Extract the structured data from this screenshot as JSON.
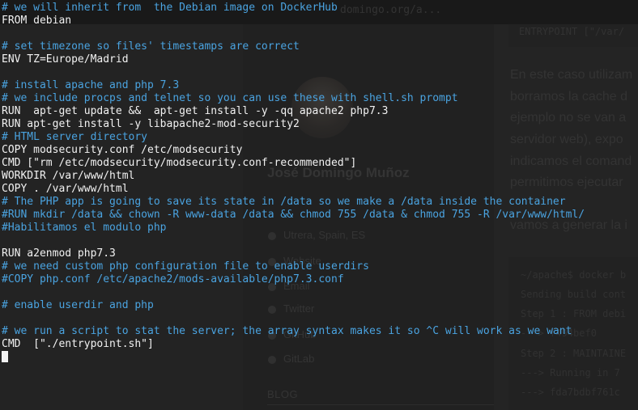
{
  "background_page": {
    "top_bar_text": "domingo.org/a...",
    "code_top": "ENTRYPOINT [\"/var/",
    "author_name": "José Domingo Muñoz",
    "location": "Utrera, Spain, ES",
    "links": [
      "Website",
      "Email",
      "Twitter",
      "GitHub",
      "GitLab"
    ],
    "blog_heading": "BLOG",
    "paragraph_lines": [
      "En este caso utilizam",
      "borramos la cache d",
      "ejemplo no se van a",
      "servidor web), expo",
      "indicamos el comand",
      "permitimos ejecutar",
      "vamos a generar la i"
    ],
    "code_lines": [
      "~/apache$ docker b",
      "Sending build cont",
      "Step 1 : FROM debi",
      " ---> f494bef0",
      "Step 2 : MAINTAINE",
      " ---> Running in 7",
      " ---> fda7bdbf761c"
    ]
  },
  "terminal": {
    "lines": [
      {
        "type": "comment",
        "text": "# we will inherit from  the Debian image on DockerHub"
      },
      {
        "type": "code",
        "text": "FROM debian"
      },
      {
        "type": "blank",
        "text": ""
      },
      {
        "type": "comment",
        "text": "# set timezone so files' timestamps are correct"
      },
      {
        "type": "code",
        "text": "ENV TZ=Europe/Madrid"
      },
      {
        "type": "blank",
        "text": ""
      },
      {
        "type": "comment",
        "text": "# install apache and php 7.3"
      },
      {
        "type": "comment",
        "text": "# we include procps and telnet so you can use these with shell.sh prompt"
      },
      {
        "type": "code",
        "text": "RUN  apt-get update &&  apt-get install -y -qq apache2 php7.3"
      },
      {
        "type": "code",
        "text": "RUN apt-get install -y libapache2-mod-security2"
      },
      {
        "type": "comment",
        "text": "# HTML server directory"
      },
      {
        "type": "code",
        "text": "COPY modsecurity.conf /etc/modsecurity"
      },
      {
        "type": "code",
        "text": "CMD [\"rm /etc/modsecurity/modsecurity.conf-recommended\"]"
      },
      {
        "type": "code",
        "text": "WORKDIR /var/www/html"
      },
      {
        "type": "code",
        "text": "COPY . /var/www/html"
      },
      {
        "type": "comment",
        "text": "# The PHP app is going to save its state in /data so we make a /data inside the container"
      },
      {
        "type": "comment",
        "text": "#RUN mkdir /data && chown -R www-data /data && chmod 755 /data & chmod 755 -R /var/www/html/"
      },
      {
        "type": "comment",
        "text": "#Habilitamos el modulo php"
      },
      {
        "type": "blank",
        "text": ""
      },
      {
        "type": "code",
        "text": "RUN a2enmod php7.3"
      },
      {
        "type": "comment",
        "text": "# we need custom php configuration file to enable userdirs"
      },
      {
        "type": "comment",
        "text": "#COPY php.conf /etc/apache2/mods-available/php7.3.conf"
      },
      {
        "type": "blank",
        "text": ""
      },
      {
        "type": "comment",
        "text": "# enable userdir and php"
      },
      {
        "type": "blank",
        "text": ""
      },
      {
        "type": "comment",
        "text": "# we run a script to stat the server; the array syntax makes it so ^C will work as we want"
      },
      {
        "type": "code",
        "text": "CMD  [\"./entrypoint.sh\"]"
      }
    ]
  },
  "colors": {
    "comment": "#4aa3e0",
    "code": "#f2f2f2"
  }
}
